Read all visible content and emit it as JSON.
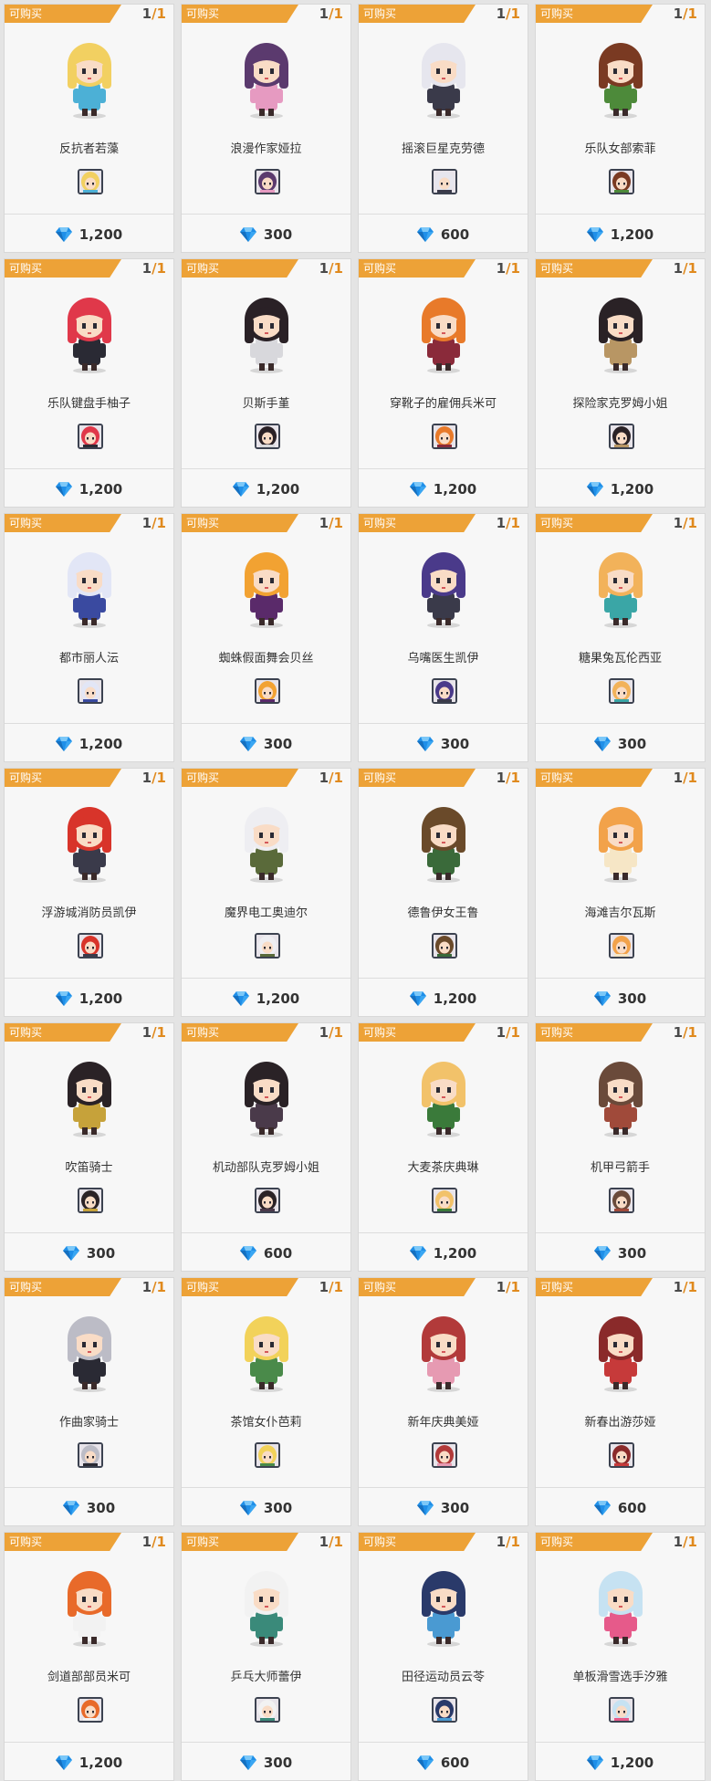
{
  "purchasable_label": "可购买",
  "currency_icon": "diamond-icon",
  "colors": {
    "tag": "#eda237",
    "stock_total": "#e08a1e",
    "diamond": "#1f8fe8"
  },
  "items": [
    {
      "name": "反抗者若藻",
      "owned": "1",
      "total": "/1",
      "price": "1,200",
      "hair": "#f2d061",
      "outfit": "#4cb0d6"
    },
    {
      "name": "浪漫作家娅拉",
      "owned": "1",
      "total": "/1",
      "price": "300",
      "hair": "#5b3a6e",
      "outfit": "#e69ac1"
    },
    {
      "name": "摇滚巨星克劳德",
      "owned": "1",
      "total": "/1",
      "price": "600",
      "hair": "#e6e6ee",
      "outfit": "#3a3a4a"
    },
    {
      "name": "乐队女部索菲",
      "owned": "1",
      "total": "/1",
      "price": "1,200",
      "hair": "#7a3a22",
      "outfit": "#4d8a3a"
    },
    {
      "name": "乐队键盘手柚子",
      "owned": "1",
      "total": "/1",
      "price": "1,200",
      "hair": "#e0384a",
      "outfit": "#2a2a34"
    },
    {
      "name": "贝斯手堇",
      "owned": "1",
      "total": "/1",
      "price": "1,200",
      "hair": "#2a2126",
      "outfit": "#d8d8dc"
    },
    {
      "name": "穿靴子的雇佣兵米可",
      "owned": "1",
      "total": "/1",
      "price": "1,200",
      "hair": "#e87a2a",
      "outfit": "#8a2a3a"
    },
    {
      "name": "探险家克罗姆小姐",
      "owned": "1",
      "total": "/1",
      "price": "1,200",
      "hair": "#2a2226",
      "outfit": "#b89664"
    },
    {
      "name": "都市丽人沄",
      "owned": "1",
      "total": "/1",
      "price": "1,200",
      "hair": "#e2e6f6",
      "outfit": "#3a4aa0"
    },
    {
      "name": "蜘蛛假面舞会贝丝",
      "owned": "1",
      "total": "/1",
      "price": "300",
      "hair": "#f2a232",
      "outfit": "#5a2a6a"
    },
    {
      "name": "乌嘴医生凯伊",
      "owned": "1",
      "total": "/1",
      "price": "300",
      "hair": "#4a3a8a",
      "outfit": "#3a3a4a"
    },
    {
      "name": "糖果兔瓦伦西亚",
      "owned": "1",
      "total": "/1",
      "price": "300",
      "hair": "#f2b25a",
      "outfit": "#3aa6a6"
    },
    {
      "name": "浮游城消防员凯伊",
      "owned": "1",
      "total": "/1",
      "price": "1,200",
      "hair": "#d8342a",
      "outfit": "#3a3a4a"
    },
    {
      "name": "魔界电工奥迪尔",
      "owned": "1",
      "total": "/1",
      "price": "1,200",
      "hair": "#eeeef2",
      "outfit": "#5a6a3a"
    },
    {
      "name": "德鲁伊女王鲁",
      "owned": "1",
      "total": "/1",
      "price": "1,200",
      "hair": "#6a4a2a",
      "outfit": "#3a6a3a"
    },
    {
      "name": "海滩吉尔瓦斯",
      "owned": "1",
      "total": "/1",
      "price": "300",
      "hair": "#f2a24a",
      "outfit": "#f6e6c6"
    },
    {
      "name": "吹笛骑士",
      "owned": "1",
      "total": "/1",
      "price": "300",
      "hair": "#2a2226",
      "outfit": "#c6a23a"
    },
    {
      "name": "机动部队克罗姆小姐",
      "owned": "1",
      "total": "/1",
      "price": "600",
      "hair": "#2a2226",
      "outfit": "#4a3a4a"
    },
    {
      "name": "大麦茶庆典琳",
      "owned": "1",
      "total": "/1",
      "price": "1,200",
      "hair": "#f2c26a",
      "outfit": "#3a7a3a"
    },
    {
      "name": "机甲弓箭手",
      "owned": "1",
      "total": "/1",
      "price": "300",
      "hair": "#6a4a3a",
      "outfit": "#a04a3a"
    },
    {
      "name": "作曲家骑士",
      "owned": "1",
      "total": "/1",
      "price": "300",
      "hair": "#bcbcc6",
      "outfit": "#2a2a34"
    },
    {
      "name": "茶馆女仆芭莉",
      "owned": "1",
      "total": "/1",
      "price": "300",
      "hair": "#f2d25a",
      "outfit": "#4a8a4a"
    },
    {
      "name": "新年庆典美娅",
      "owned": "1",
      "total": "/1",
      "price": "300",
      "hair": "#b23a3a",
      "outfit": "#e69ab2"
    },
    {
      "name": "新春出游莎娅",
      "owned": "1",
      "total": "/1",
      "price": "600",
      "hair": "#8a2a2a",
      "outfit": "#c63a3a"
    },
    {
      "name": "剑道部部员米可",
      "owned": "1",
      "total": "/1",
      "price": "1,200",
      "hair": "#e86a2a",
      "outfit": "#f2f2f2"
    },
    {
      "name": "乒乓大师蕾伊",
      "owned": "1",
      "total": "/1",
      "price": "300",
      "hair": "#f2f2f2",
      "outfit": "#3a8a7a"
    },
    {
      "name": "田径运动员云苓",
      "owned": "1",
      "total": "/1",
      "price": "600",
      "hair": "#2a3a6a",
      "outfit": "#4a9ad2"
    },
    {
      "name": "单板滑雪选手汐雅",
      "owned": "1",
      "total": "/1",
      "price": "1,200",
      "hair": "#c6e2f2",
      "outfit": "#e65a8a"
    }
  ]
}
